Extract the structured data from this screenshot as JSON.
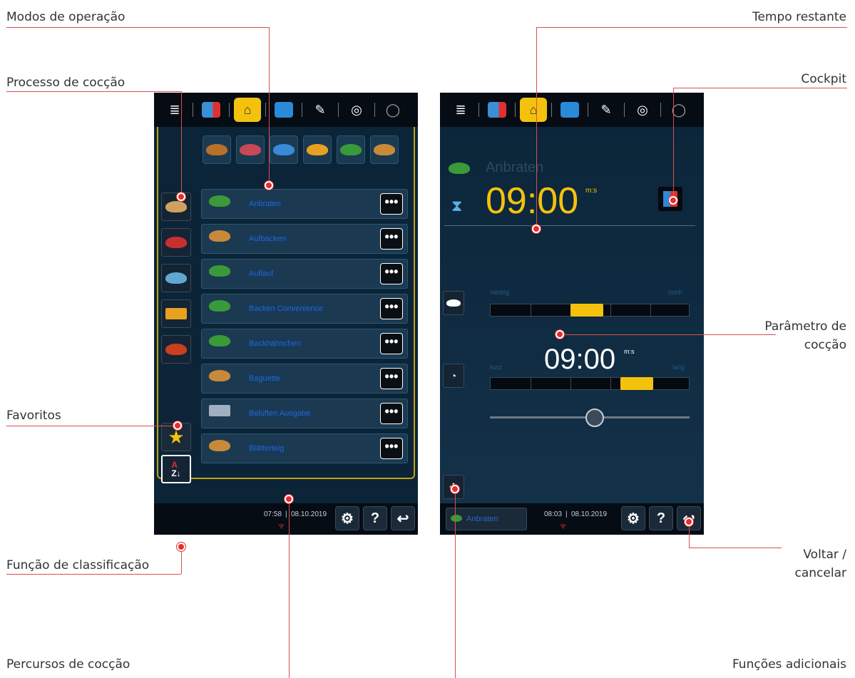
{
  "callouts": {
    "modos": "Modos de operação",
    "processo": "Processo de cocção",
    "favoritos": "Favoritos",
    "classificacao": "Função de classificação",
    "percursos": "Percursos de cocção",
    "tempo": "Tempo restante",
    "cockpit": "Cockpit",
    "parametro_1": "Parâmetro de",
    "parametro_2": "cocção",
    "voltar_1": "Voltar /",
    "voltar_2": "cancelar",
    "funcoes": "Funções adicionais"
  },
  "left_screen": {
    "tabs": [
      "menu-icon",
      "cooking-icon",
      "chef-hat-icon",
      "programs-icon",
      "edit-icon",
      "growth-icon",
      "search-icon"
    ],
    "items": [
      {
        "label": "Anbraten",
        "icon": "vegetable-icon"
      },
      {
        "label": "Aufbacken",
        "icon": "bread-icon"
      },
      {
        "label": "Auflauf",
        "icon": "vegetable-icon"
      },
      {
        "label": "Backen Convenience",
        "icon": "vegetable-icon"
      },
      {
        "label": "Backhähnchen",
        "icon": "vegetable-icon"
      },
      {
        "label": "Baguette",
        "icon": "bread-icon"
      },
      {
        "label": "Belüften Ausgabe",
        "icon": "rack-icon"
      },
      {
        "label": "Blätterteig",
        "icon": "bread-icon"
      }
    ],
    "more_label": "•••",
    "time": "07:58",
    "date": "08.10.2019",
    "help": "?",
    "settings": "⚙",
    "back": "↩"
  },
  "right_screen": {
    "title": "Anbraten",
    "remaining": "09:00",
    "remaining_unit": "m:s",
    "param1_low": "niedrig",
    "param1_high": "hoch",
    "param2_time": "09:00",
    "param2_unit": "m:s",
    "param2_low": "kurz",
    "param2_high": "lang",
    "footer_label": "Anbraten",
    "time": "08:03",
    "date": "08.10.2019",
    "help": "?",
    "settings": "⚙",
    "back": "↩"
  },
  "colors": {
    "accent": "#f4c20d",
    "callout": "#d94f4f",
    "screen": "#0b2438"
  }
}
